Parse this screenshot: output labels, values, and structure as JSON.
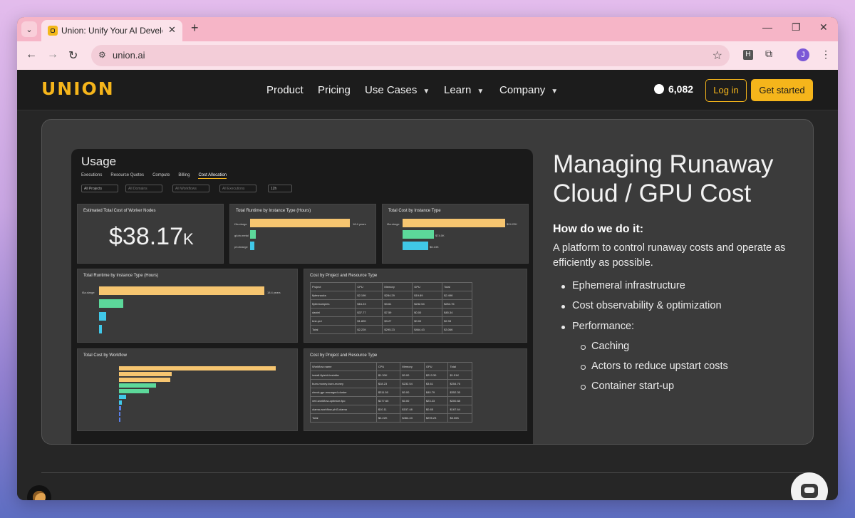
{
  "browser": {
    "tab_title": "Union: Unify Your AI Development",
    "url": "union.ai",
    "new_tab_icon": "plus-icon",
    "profile_initial": "J",
    "ext_h_label": "H"
  },
  "site": {
    "logo": "UNION",
    "nav": [
      {
        "label": "Product"
      },
      {
        "label": "Pricing"
      },
      {
        "label": "Use Cases"
      },
      {
        "label": "Learn"
      },
      {
        "label": "Company"
      }
    ],
    "github_stars": "6,082",
    "login": "Log in",
    "get_started": "Get started",
    "accent_color": "#f5b51b"
  },
  "dashboard": {
    "title": "Usage",
    "tabs": [
      "Executions",
      "Resource Quotes",
      "Compute",
      "Billing",
      "Cost Allocation"
    ],
    "filters": [
      "All Projects",
      "All Domains",
      "All Workflows",
      "All Executions",
      "12h"
    ],
    "stat_title": "Estimated Total Cost of Worker Nodes",
    "stat_value": "$38.17",
    "stat_unit": "K",
    "panel_runtime_small": "Total Runtime by Instance Type (Hours)",
    "panel_cost_instance": "Total Cost by Instance Type",
    "panel_runtime_big": "Total Runtime by Instance Type (Hours)",
    "panel_cost_project": "Cost by Project and Resource Type",
    "panel_cost_workflow": "Total Cost by Workflow",
    "panel_cost_project2": "Cost by Project and Resource Type",
    "instances": [
      "t3a.xlarge",
      "g4dn.metal",
      "p3.8xlarge"
    ],
    "runtime_labels": [
      "18.4 years",
      "0.2 weeks",
      "2.0 weeks"
    ],
    "cost_labels": [
      "$24.22K",
      "$74.0K",
      "$6.13K"
    ],
    "table_headers": [
      "Project",
      "CPU",
      "Memory",
      "GPU",
      "Total"
    ],
    "table_rows": [
      [
        "flytesnacks",
        "$2.19K",
        "$284.29",
        "$19.89",
        "$2.49K"
      ],
      [
        "flyteexamples",
        "$16.23",
        "$3.61",
        "$232.54",
        "$254.76"
      ],
      [
        "daniel",
        "$37.77",
        "$7.59",
        "$0.00",
        "$45.34"
      ],
      [
        "test-prd",
        "$1.82K",
        "$3.27",
        "$0.00",
        "$2.33"
      ],
      [
        "Total",
        "$2.22K",
        "$295.23",
        "$464.43",
        "$3.06K"
      ]
    ],
    "table2_headers": [
      "Workflow name",
      "CPU",
      "Memory",
      "GPU",
      "Total"
    ],
    "table2_rows": [
      [
        "install-flytekit-installer",
        "$1.30K",
        "$0.00",
        "$213.30",
        "$1.51K"
      ],
      [
        "burn-money-burn-money",
        "$18.23",
        "$232.54",
        "$3.61",
        "$254.76"
      ],
      [
        "check-gpr-managed-cluster",
        "$311.50",
        "$0.00",
        "$40.79",
        "$352.35"
      ],
      [
        "verl-workflow-optimize-fpo",
        "$177.65",
        "$0.00",
        "$23.23",
        "$200.88"
      ],
      [
        "olama-workflow-phi3-olama",
        "$10.11",
        "$157.48",
        "$0.85",
        "$167.64"
      ],
      [
        "Total",
        "$2.22K",
        "$464.43",
        "$295.23",
        "$3.06K"
      ]
    ],
    "workflows": [
      "install-flytekit-installer",
      "burn-money-burn-money",
      "check-gpr-managed-cluster-yarn",
      "verl-workflow-optimize-fpo",
      "olama-workflow-phi3-olama",
      "ef-wf",
      "flytegen-demo-debug-my-bad-task",
      "node-group-check-memstate",
      "flytegen-simple-simple-eager-workflow",
      "flytegen-debug-my-bad-tasks"
    ],
    "workflow_values": [
      "$1.50K",
      "$304.76",
      "$352.35",
      "$200.88",
      "$167.64",
      "$45.34",
      "$11.57",
      "$7.00",
      "$2.33",
      "$2.33"
    ]
  },
  "hero": {
    "headline": "Managing Runaway Cloud / GPU Cost",
    "subhead": "How do we do it:",
    "description": "A platform to control runaway costs and operate as efficiently as possible.",
    "bullets": [
      "Ephemeral infrastructure",
      "Cost observability & optimization",
      "Performance:"
    ],
    "sub_bullets": [
      "Caching",
      "Actors to reduce upstart costs",
      "Container start-up"
    ]
  }
}
